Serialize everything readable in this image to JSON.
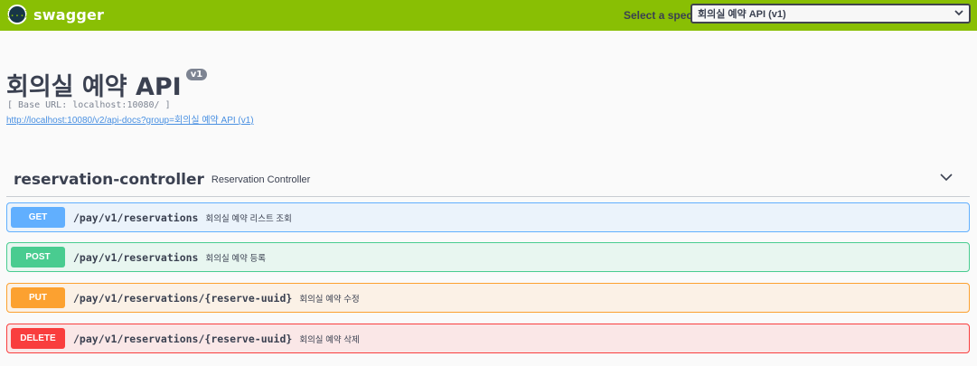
{
  "topbar": {
    "logo_glyph": "{...}",
    "logo_text": "swagger",
    "spec_label": "Select a spec",
    "spec_selected": "회의실 예약 API (v1)",
    "brand_color": "#89bf04"
  },
  "info": {
    "title": "회의실 예약 API",
    "version": "v1",
    "base_url": "[ Base URL: localhost:10080/ ]",
    "docs_link": "http://localhost:10080/v2/api-docs?group=회의실 예약 API (v1)"
  },
  "tag": {
    "name": "reservation-controller",
    "description": "Reservation Controller",
    "chevron_icon": "chevron-down-icon"
  },
  "operations": [
    {
      "method": "GET",
      "path": "/pay/v1/reservations",
      "summary": "회의실 예약 리스트 조회",
      "color": "#61affe"
    },
    {
      "method": "POST",
      "path": "/pay/v1/reservations",
      "summary": "회의실 예약 등록",
      "color": "#49cc90"
    },
    {
      "method": "PUT",
      "path": "/pay/v1/reservations/{reserve-uuid}",
      "summary": "회의실 예약 수정",
      "color": "#fca130"
    },
    {
      "method": "DELETE",
      "path": "/pay/v1/reservations/{reserve-uuid}",
      "summary": "회의실 예약 삭제",
      "color": "#f93e3e"
    }
  ]
}
